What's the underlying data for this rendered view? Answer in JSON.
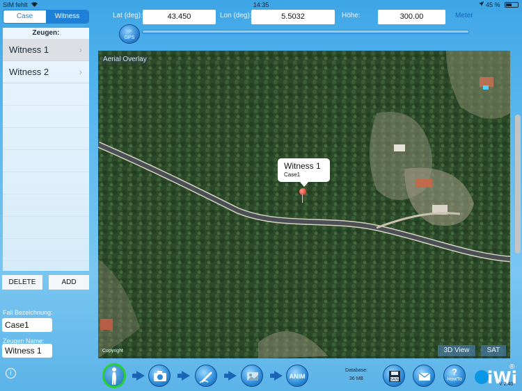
{
  "status_bar": {
    "carrier": "SIM fehlt",
    "time": "14:35",
    "battery": "45 %"
  },
  "tabs": [
    {
      "label": "Case"
    },
    {
      "label": "Witness"
    }
  ],
  "witness_list": {
    "header": "Zeugen:",
    "items": [
      {
        "label": "Witness 1"
      },
      {
        "label": "Witness 2"
      }
    ]
  },
  "buttons": {
    "delete": "DELETE",
    "add": "ADD"
  },
  "case_name": {
    "label": "Fall Bezeichnung:",
    "value": "Case1"
  },
  "witness_name": {
    "label": "Zeugen Name:",
    "value": "Witness 1"
  },
  "coords": {
    "lat_label": "Lat (deg):",
    "lat_value": "43.450",
    "lon_label": "Lon (deg):",
    "lon_value": "5.5032",
    "height_label": "Höhe:",
    "height_value": "300.00",
    "unit": "Meter"
  },
  "gps_button": {
    "arrow": "->",
    "label": "GPS"
  },
  "map": {
    "overlay_label": "Aerial Overlay",
    "copyright": "Copyright",
    "callout_title": "Witness 1",
    "callout_subtitle": "Case1",
    "view_3d_label": "3D View",
    "sat_label": "SAT"
  },
  "toolbar": {
    "anim_label": "ANIM",
    "database_label": "Database:",
    "database_size": "36 MB",
    "save_label": "SAVE",
    "howto_symbol": "?",
    "howto_label": "HowTo"
  },
  "logo": {
    "name": "iWi",
    "reg": "®",
    "version": "V 2.40"
  },
  "colors": {
    "accent": "#1e7fd6",
    "pin": "#d21f12",
    "active_ring": "#27d12f"
  }
}
